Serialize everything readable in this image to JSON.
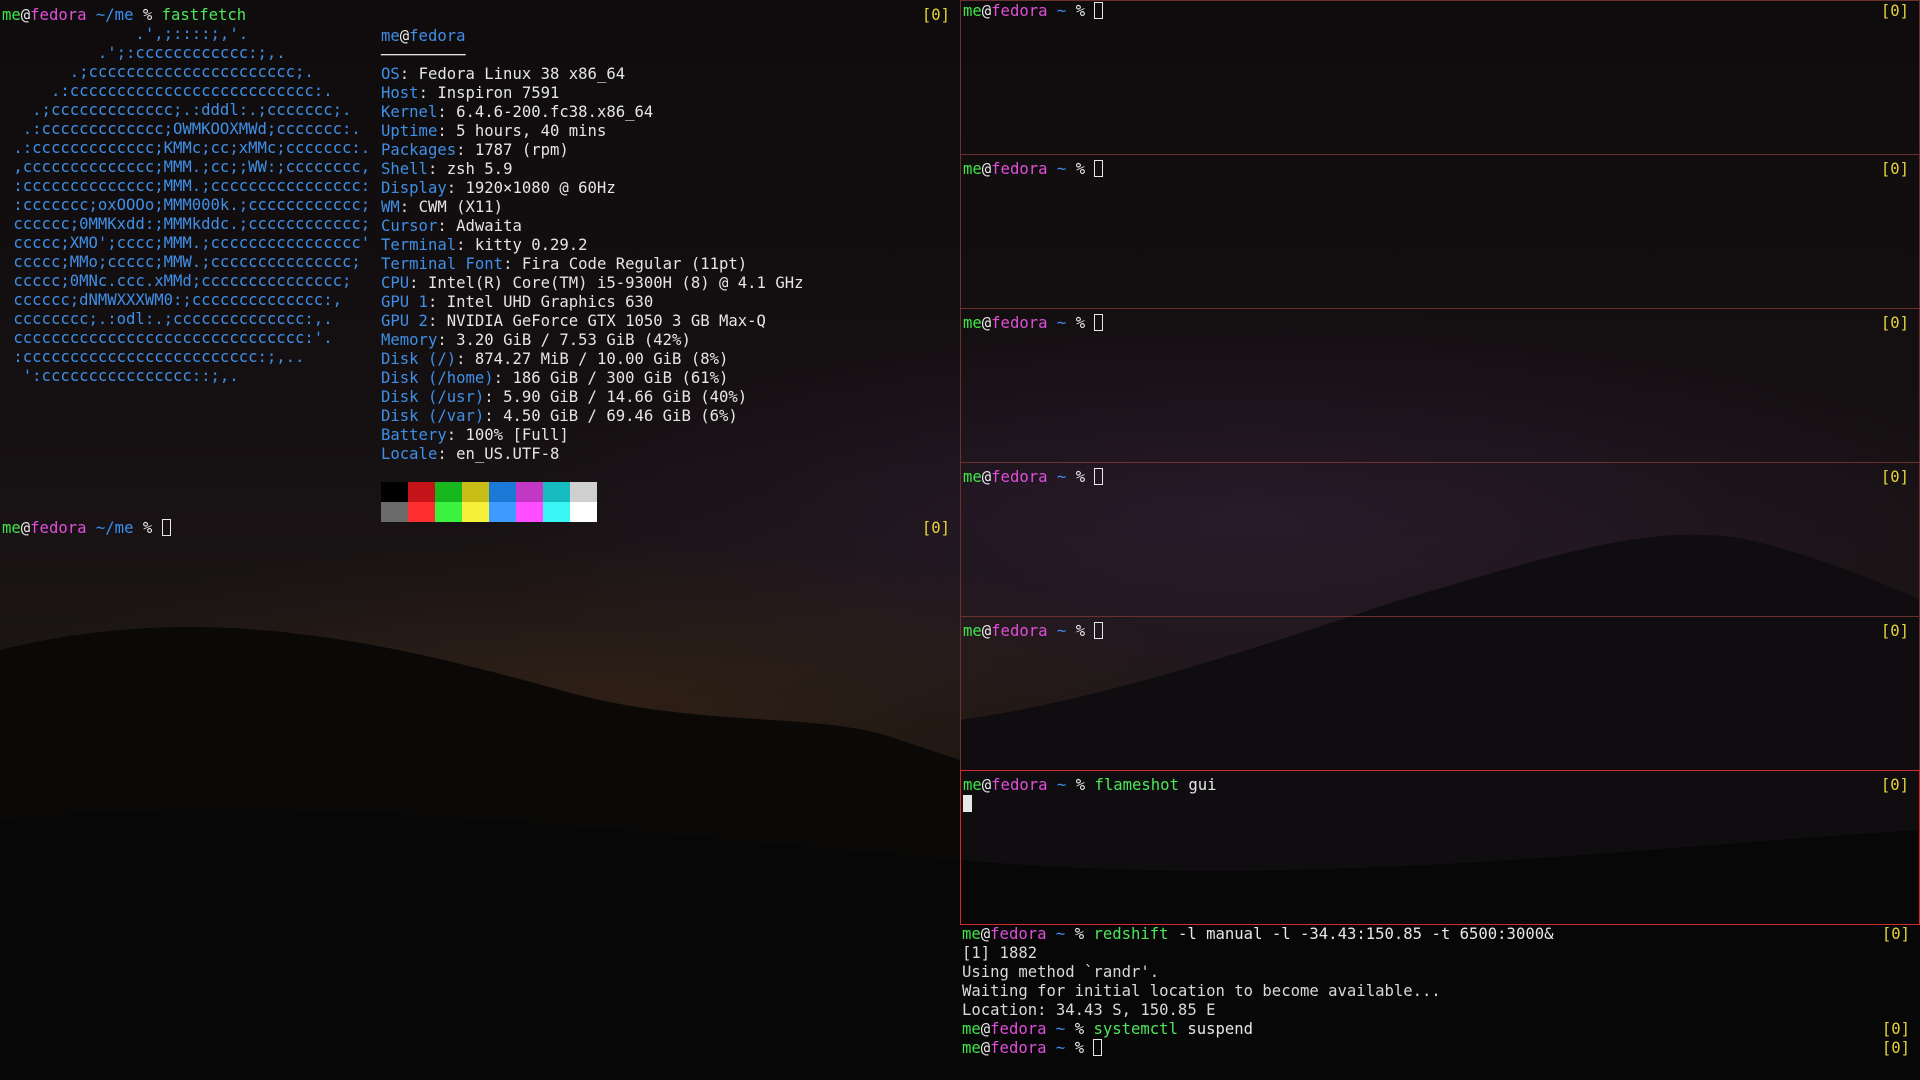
{
  "counter": "[0]",
  "prompt": {
    "user": "me",
    "at": "@",
    "host": "fedora",
    "home_path": "~",
    "left_path": "~/me",
    "symbol": "%"
  },
  "left_pane": {
    "command": "fastfetch",
    "logo_lines": [
      "              .',;::::;,'.",
      "          .';:cccccccccccc:;,.",
      "       .;cccccccccccccccccccccc;.",
      "     .:cccccccccccccccccccccccccc:.",
      "   .;ccccccccccccc;.:dddl:.;ccccccc;.",
      "  .:ccccccccccccc;OWMKOOXMWd;ccccccc:.",
      " .:ccccccccccccc;KMMc;cc;xMMc;ccccccc:.",
      " ,cccccccccccccc;MMM.;cc;;WW:;cccccccc,",
      " :cccccccccccccc;MMM.;cccccccccccccccc:",
      " :ccccccc;oxOOOo;MMM000k.;cccccccccccc;",
      " cccccc;0MMKxdd:;MMMkddc.;cccccccccccc;",
      " ccccc;XMO';cccc;MMM.;cccccccccccccccc'",
      " ccccc;MMo;ccccc;MMW.;ccccccccccccccc;",
      " ccccc;0MNc.ccc.xMMd;ccccccccccccccc;",
      " cccccc;dNMWXXXWM0:;cccccccccccccc:,",
      " cccccccc;.:odl:.;cccccccccccccc:,.",
      " ccccccccccccccccccccccccccccccc:'.",
      " :ccccccccccccccccccccccccc:;,..",
      "  ':cccccccccccccccc::;,."
    ],
    "title_user": "me",
    "title_host": "fedora",
    "underline": "─────────",
    "info": [
      {
        "key": "OS",
        "value": "Fedora Linux 38 x86_64"
      },
      {
        "key": "Host",
        "value": "Inspiron 7591"
      },
      {
        "key": "Kernel",
        "value": "6.4.6-200.fc38.x86_64"
      },
      {
        "key": "Uptime",
        "value": "5 hours, 40 mins"
      },
      {
        "key": "Packages",
        "value": "1787 (rpm)"
      },
      {
        "key": "Shell",
        "value": "zsh 5.9"
      },
      {
        "key": "Display",
        "value": "1920×1080 @ 60Hz"
      },
      {
        "key": "WM",
        "value": "CWM (X11)"
      },
      {
        "key": "Cursor",
        "value": "Adwaita"
      },
      {
        "key": "Terminal",
        "value": "kitty 0.29.2"
      },
      {
        "key": "Terminal Font",
        "value": "Fira Code Regular (11pt)"
      },
      {
        "key": "CPU",
        "value": "Intel(R) Core(TM) i5-9300H (8) @ 4.1 GHz"
      },
      {
        "key": "GPU 1",
        "value": "Intel UHD Graphics 630"
      },
      {
        "key": "GPU 2",
        "value": "NVIDIA GeForce GTX 1050 3 GB Max-Q"
      },
      {
        "key": "Memory",
        "value": "3.20 GiB / 7.53 GiB (42%)"
      },
      {
        "key": "Disk (/)",
        "value": "874.27 MiB / 10.00 GiB (8%)"
      },
      {
        "key": "Disk (/home)",
        "value": "186 GiB / 300 GiB (61%)"
      },
      {
        "key": "Disk (/usr)",
        "value": "5.90 GiB / 14.66 GiB (40%)"
      },
      {
        "key": "Disk (/var)",
        "value": "4.50 GiB / 69.46 GiB (6%)"
      },
      {
        "key": "Battery",
        "value": "100% [Full]"
      },
      {
        "key": "Locale",
        "value": "en_US.UTF-8"
      }
    ],
    "palette_colors": [
      "#000000",
      "#c4141a",
      "#17b81d",
      "#c8bd16",
      "#1a78d6",
      "#c238c4",
      "#17bcc0",
      "#cfcfcf",
      "#6b6b6b",
      "#ff2e2e",
      "#3af23f",
      "#f5f03a",
      "#3d9bff",
      "#ff4cff",
      "#39f5f5",
      "#ffffff"
    ]
  },
  "right_panes": [
    {
      "command": "",
      "args": "",
      "output": []
    },
    {
      "command": "",
      "args": "",
      "output": []
    },
    {
      "command": "",
      "args": "",
      "output": []
    },
    {
      "command": "",
      "args": "",
      "output": []
    },
    {
      "command": "",
      "args": "",
      "output": []
    },
    {
      "command": "flameshot",
      "args": " gui",
      "output": []
    },
    {
      "command": "redshift",
      "args": " -l manual -l -34.43:150.85 -t 6500:3000&",
      "output": [
        "[1] 1882",
        "Using method `randr'.",
        "Waiting for initial location to become available...",
        "Location: 34.43 S, 150.85 E"
      ],
      "followups": [
        {
          "command": "systemctl",
          "args": " suspend"
        }
      ]
    }
  ],
  "colors": {
    "user": "#3ee64a",
    "host": "#e04fd9",
    "path": "#3c8ff0",
    "counter": "#e6d43a",
    "active_border": "#d32a2a",
    "pane_border": "#6b3030"
  }
}
